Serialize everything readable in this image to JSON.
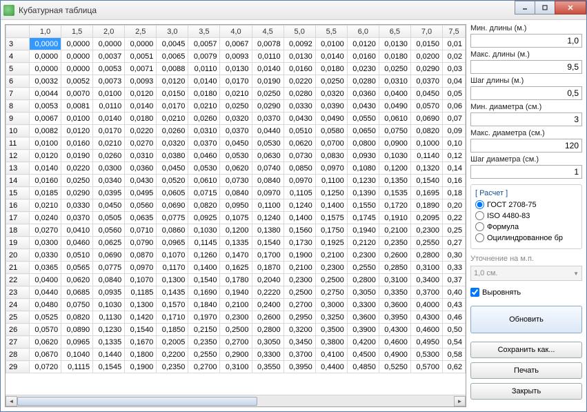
{
  "title": "Кубатурная таблица",
  "columns": [
    "1,0",
    "1,5",
    "2,0",
    "2,5",
    "3,0",
    "3,5",
    "4,0",
    "4,5",
    "5,0",
    "5,5",
    "6,0",
    "6,5",
    "7,0",
    "7,5"
  ],
  "rows": [
    {
      "h": "3",
      "c": [
        "0,0000",
        "0,0000",
        "0,0000",
        "0,0000",
        "0,0045",
        "0,0057",
        "0,0067",
        "0,0078",
        "0,0092",
        "0,0100",
        "0,0120",
        "0,0130",
        "0,0150",
        "0,01"
      ]
    },
    {
      "h": "4",
      "c": [
        "0,0000",
        "0,0000",
        "0,0037",
        "0,0051",
        "0,0065",
        "0,0079",
        "0,0093",
        "0,0110",
        "0,0130",
        "0,0140",
        "0,0160",
        "0,0180",
        "0,0200",
        "0,02"
      ]
    },
    {
      "h": "5",
      "c": [
        "0,0000",
        "0,0000",
        "0,0053",
        "0,0071",
        "0,0088",
        "0,0110",
        "0,0130",
        "0,0140",
        "0,0160",
        "0,0180",
        "0,0230",
        "0,0250",
        "0,0290",
        "0,03"
      ]
    },
    {
      "h": "6",
      "c": [
        "0,0032",
        "0,0052",
        "0,0073",
        "0,0093",
        "0,0120",
        "0,0140",
        "0,0170",
        "0,0190",
        "0,0220",
        "0,0250",
        "0,0280",
        "0,0310",
        "0,0370",
        "0,04"
      ]
    },
    {
      "h": "7",
      "c": [
        "0,0044",
        "0,0070",
        "0,0100",
        "0,0120",
        "0,0150",
        "0,0180",
        "0,0210",
        "0,0250",
        "0,0280",
        "0,0320",
        "0,0360",
        "0,0400",
        "0,0450",
        "0,05"
      ]
    },
    {
      "h": "8",
      "c": [
        "0,0053",
        "0,0081",
        "0,0110",
        "0,0140",
        "0,0170",
        "0,0210",
        "0,0250",
        "0,0290",
        "0,0330",
        "0,0390",
        "0,0430",
        "0,0490",
        "0,0570",
        "0,06"
      ]
    },
    {
      "h": "9",
      "c": [
        "0,0067",
        "0,0100",
        "0,0140",
        "0,0180",
        "0,0210",
        "0,0260",
        "0,0320",
        "0,0370",
        "0,0430",
        "0,0490",
        "0,0550",
        "0,0610",
        "0,0690",
        "0,07"
      ]
    },
    {
      "h": "10",
      "c": [
        "0,0082",
        "0,0120",
        "0,0170",
        "0,0220",
        "0,0260",
        "0,0310",
        "0,0370",
        "0,0440",
        "0,0510",
        "0,0580",
        "0,0650",
        "0,0750",
        "0,0820",
        "0,09"
      ]
    },
    {
      "h": "11",
      "c": [
        "0,0100",
        "0,0160",
        "0,0210",
        "0,0270",
        "0,0320",
        "0,0370",
        "0,0450",
        "0,0530",
        "0,0620",
        "0,0700",
        "0,0800",
        "0,0900",
        "0,1000",
        "0,10"
      ]
    },
    {
      "h": "12",
      "c": [
        "0,0120",
        "0,0190",
        "0,0260",
        "0,0310",
        "0,0380",
        "0,0460",
        "0,0530",
        "0,0630",
        "0,0730",
        "0,0830",
        "0,0930",
        "0,1030",
        "0,1140",
        "0,12"
      ]
    },
    {
      "h": "13",
      "c": [
        "0,0140",
        "0,0220",
        "0,0300",
        "0,0360",
        "0,0450",
        "0,0530",
        "0,0620",
        "0,0740",
        "0,0850",
        "0,0970",
        "0,1080",
        "0,1200",
        "0,1320",
        "0,14"
      ]
    },
    {
      "h": "14",
      "c": [
        "0,0160",
        "0,0250",
        "0,0340",
        "0,0430",
        "0,0520",
        "0,0610",
        "0,0730",
        "0,0840",
        "0,0970",
        "0,1100",
        "0,1230",
        "0,1350",
        "0,1540",
        "0,16"
      ]
    },
    {
      "h": "15",
      "c": [
        "0,0185",
        "0,0290",
        "0,0395",
        "0,0495",
        "0,0605",
        "0,0715",
        "0,0840",
        "0,0970",
        "0,1105",
        "0,1250",
        "0,1390",
        "0,1535",
        "0,1695",
        "0,18"
      ]
    },
    {
      "h": "16",
      "c": [
        "0,0210",
        "0,0330",
        "0,0450",
        "0,0560",
        "0,0690",
        "0,0820",
        "0,0950",
        "0,1100",
        "0,1240",
        "0,1400",
        "0,1550",
        "0,1720",
        "0,1890",
        "0,20"
      ]
    },
    {
      "h": "17",
      "c": [
        "0,0240",
        "0,0370",
        "0,0505",
        "0,0635",
        "0,0775",
        "0,0925",
        "0,1075",
        "0,1240",
        "0,1400",
        "0,1575",
        "0,1745",
        "0,1910",
        "0,2095",
        "0,22"
      ]
    },
    {
      "h": "18",
      "c": [
        "0,0270",
        "0,0410",
        "0,0560",
        "0,0710",
        "0,0860",
        "0,1030",
        "0,1200",
        "0,1380",
        "0,1560",
        "0,1750",
        "0,1940",
        "0,2100",
        "0,2300",
        "0,25"
      ]
    },
    {
      "h": "19",
      "c": [
        "0,0300",
        "0,0460",
        "0,0625",
        "0,0790",
        "0,0965",
        "0,1145",
        "0,1335",
        "0,1540",
        "0,1730",
        "0,1925",
        "0,2120",
        "0,2350",
        "0,2550",
        "0,27"
      ]
    },
    {
      "h": "20",
      "c": [
        "0,0330",
        "0,0510",
        "0,0690",
        "0,0870",
        "0,1070",
        "0,1260",
        "0,1470",
        "0,1700",
        "0,1900",
        "0,2100",
        "0,2300",
        "0,2600",
        "0,2800",
        "0,30"
      ]
    },
    {
      "h": "21",
      "c": [
        "0,0365",
        "0,0565",
        "0,0775",
        "0,0970",
        "0,1170",
        "0,1400",
        "0,1625",
        "0,1870",
        "0,2100",
        "0,2300",
        "0,2550",
        "0,2850",
        "0,3100",
        "0,33"
      ]
    },
    {
      "h": "22",
      "c": [
        "0,0400",
        "0,0620",
        "0,0840",
        "0,1070",
        "0,1300",
        "0,1540",
        "0,1780",
        "0,2040",
        "0,2300",
        "0,2500",
        "0,2800",
        "0,3100",
        "0,3400",
        "0,37"
      ]
    },
    {
      "h": "23",
      "c": [
        "0,0440",
        "0,0685",
        "0,0935",
        "0,1185",
        "0,1435",
        "0,1690",
        "0,1940",
        "0,2220",
        "0,2500",
        "0,2750",
        "0,3050",
        "0,3350",
        "0,3700",
        "0,40"
      ]
    },
    {
      "h": "24",
      "c": [
        "0,0480",
        "0,0750",
        "0,1030",
        "0,1300",
        "0,1570",
        "0,1840",
        "0,2100",
        "0,2400",
        "0,2700",
        "0,3000",
        "0,3300",
        "0,3600",
        "0,4000",
        "0,43"
      ]
    },
    {
      "h": "25",
      "c": [
        "0,0525",
        "0,0820",
        "0,1130",
        "0,1420",
        "0,1710",
        "0,1970",
        "0,2300",
        "0,2600",
        "0,2950",
        "0,3250",
        "0,3600",
        "0,3950",
        "0,4300",
        "0,46"
      ]
    },
    {
      "h": "26",
      "c": [
        "0,0570",
        "0,0890",
        "0,1230",
        "0,1540",
        "0,1850",
        "0,2150",
        "0,2500",
        "0,2800",
        "0,3200",
        "0,3500",
        "0,3900",
        "0,4300",
        "0,4600",
        "0,50"
      ]
    },
    {
      "h": "27",
      "c": [
        "0,0620",
        "0,0965",
        "0,1335",
        "0,1670",
        "0,2005",
        "0,2350",
        "0,2700",
        "0,3050",
        "0,3450",
        "0,3800",
        "0,4200",
        "0,4600",
        "0,4950",
        "0,54"
      ]
    },
    {
      "h": "28",
      "c": [
        "0,0670",
        "0,1040",
        "0,1440",
        "0,1800",
        "0,2200",
        "0,2550",
        "0,2900",
        "0,3300",
        "0,3700",
        "0,4100",
        "0,4500",
        "0,4900",
        "0,5300",
        "0,58"
      ]
    },
    {
      "h": "29",
      "c": [
        "0,0720",
        "0,1115",
        "0,1545",
        "0,1900",
        "0,2350",
        "0,2700",
        "0,3100",
        "0,3550",
        "0,3950",
        "0,4400",
        "0,4850",
        "0,5250",
        "0,5700",
        "0,62"
      ]
    }
  ],
  "params": {
    "minLenLabel": "Мин. длины (м.)",
    "minLen": "1,0",
    "maxLenLabel": "Макс. длины (м.)",
    "maxLen": "9,5",
    "stepLenLabel": "Шаг длины (м.)",
    "stepLen": "0,5",
    "minDiaLabel": "Мин. диаметра (см.)",
    "minDia": "3",
    "maxDiaLabel": "Макс. диаметра (см.)",
    "maxDia": "120",
    "stepDiaLabel": "Шаг диаметра (см.)",
    "stepDia": "1"
  },
  "calc": {
    "groupLabel": "[ Расчет ]",
    "opt1": "ГОСТ 2708-75",
    "opt2": "ISO 4480-83",
    "opt3": "Формула",
    "opt4": "Оцилиндрованное бр"
  },
  "refineLabel": "Уточнение на м.п.",
  "refineCombo": "1,0 см.",
  "alignLabel": "Выровнять",
  "buttons": {
    "update": "Обновить",
    "saveAs": "Сохранить как...",
    "print": "Печать",
    "close": "Закрыть"
  }
}
